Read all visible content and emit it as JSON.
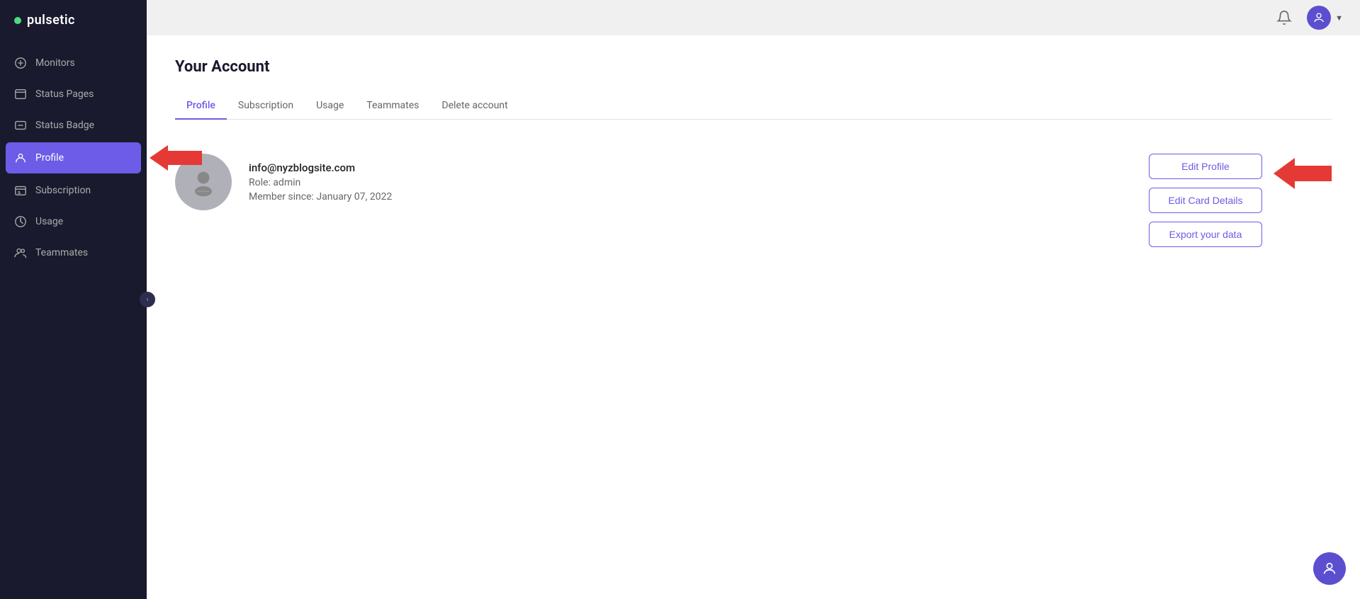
{
  "app": {
    "logo": "pulsetic",
    "logo_dot_color": "#4ade80"
  },
  "sidebar": {
    "items": [
      {
        "id": "monitors",
        "label": "Monitors",
        "icon": "monitor-icon",
        "active": false
      },
      {
        "id": "status-pages",
        "label": "Status Pages",
        "icon": "status-pages-icon",
        "active": false
      },
      {
        "id": "status-badge",
        "label": "Status Badge",
        "icon": "status-badge-icon",
        "active": false
      },
      {
        "id": "profile",
        "label": "Profile",
        "icon": "profile-icon",
        "active": true
      },
      {
        "id": "subscription",
        "label": "Subscription",
        "icon": "subscription-icon",
        "active": false
      },
      {
        "id": "usage",
        "label": "Usage",
        "icon": "usage-icon",
        "active": false
      },
      {
        "id": "teammates",
        "label": "Teammates",
        "icon": "teammates-icon",
        "active": false
      }
    ]
  },
  "topbar": {
    "notification_icon": "bell-icon",
    "user_icon": "user-circle-icon"
  },
  "page": {
    "title": "Your Account",
    "tabs": [
      {
        "id": "profile",
        "label": "Profile",
        "active": true
      },
      {
        "id": "subscription",
        "label": "Subscription",
        "active": false
      },
      {
        "id": "usage",
        "label": "Usage",
        "active": false
      },
      {
        "id": "teammates",
        "label": "Teammates",
        "active": false
      },
      {
        "id": "delete-account",
        "label": "Delete account",
        "active": false
      }
    ],
    "profile": {
      "email": "info@nyzblogsite.com",
      "role_label": "Role: admin",
      "member_since": "Member since: January 07, 2022"
    },
    "buttons": {
      "edit_profile": "Edit Profile",
      "edit_card": "Edit Card Details",
      "export_data": "Export your data"
    }
  }
}
